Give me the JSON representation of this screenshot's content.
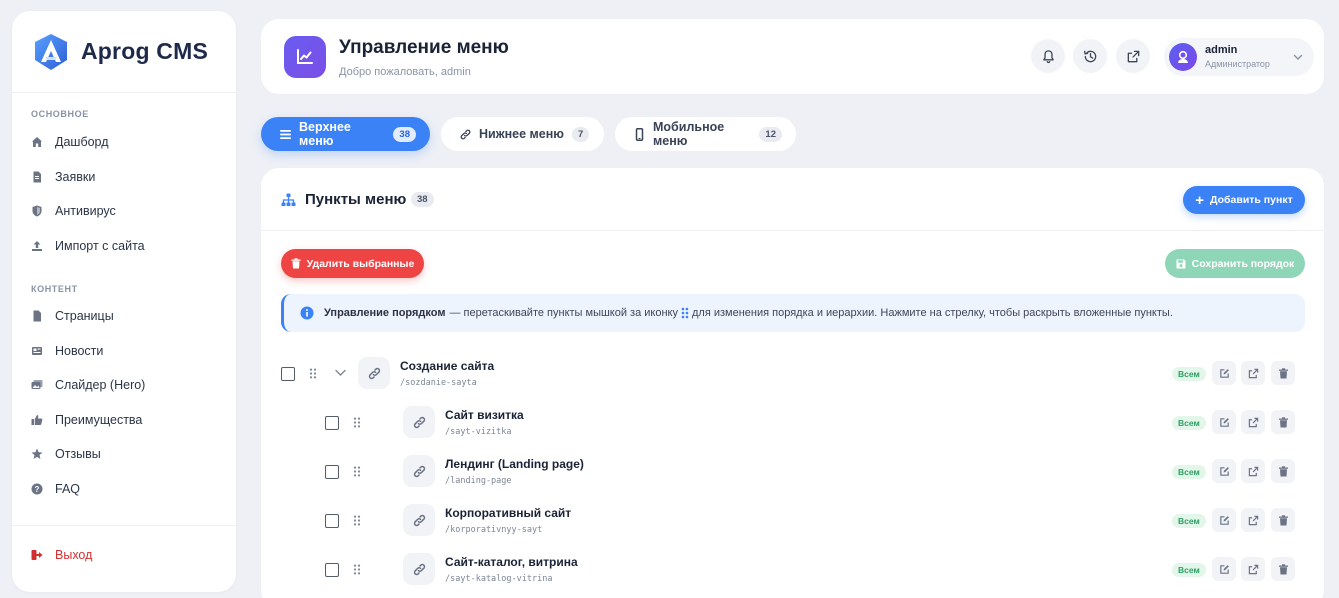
{
  "brand": {
    "name": "Aprog CMS"
  },
  "sidebar": {
    "section_main": "ОСНОВНОЕ",
    "main_items": [
      {
        "label": "Дашборд",
        "icon": "home-icon"
      },
      {
        "label": "Заявки",
        "icon": "file-icon"
      },
      {
        "label": "Антивирус",
        "icon": "shield-icon"
      },
      {
        "label": "Импорт с сайта",
        "icon": "upload-icon"
      }
    ],
    "section_content": "КОНТЕНТ",
    "content_items": [
      {
        "label": "Страницы",
        "icon": "page-icon"
      },
      {
        "label": "Новости",
        "icon": "newspaper-icon"
      },
      {
        "label": "Слайдер (Hero)",
        "icon": "images-icon"
      },
      {
        "label": "Преимущества",
        "icon": "thumbs-up-icon"
      },
      {
        "label": "Отзывы",
        "icon": "star-icon"
      },
      {
        "label": "FAQ",
        "icon": "question-icon"
      }
    ],
    "logout": "Выход"
  },
  "header": {
    "title": "Управление меню",
    "subtitle": "Добро пожаловать, admin",
    "user_name": "admin",
    "user_role": "Администратор"
  },
  "tabs": [
    {
      "label": "Верхнее меню",
      "count": "38",
      "icon": "bars-icon",
      "active": true
    },
    {
      "label": "Нижнее меню",
      "count": "7",
      "icon": "link-icon",
      "active": false
    },
    {
      "label": "Мобильное меню",
      "count": "12",
      "icon": "mobile-icon",
      "active": false
    }
  ],
  "panel": {
    "title": "Пункты меню",
    "count": "38",
    "add_label": "Добавить пункт",
    "delete_label": "Удалить выбранные",
    "save_label": "Сохранить порядок",
    "info_bold": "Управление порядком",
    "info_text_1": "— перетаскивайте пункты мышкой за иконку",
    "info_text_2": "для изменения порядка и иерархии. Нажмите на стрелку, чтобы раскрыть вложенные пункты."
  },
  "items": [
    {
      "title": "Создание сайта",
      "slug": "/sozdanie-sayta",
      "badge": "Всем"
    },
    {
      "title": "Сайт визитка",
      "slug": "/sayt-vizitka",
      "badge": "Всем"
    },
    {
      "title": "Лендинг (Landing page)",
      "slug": "/landing-page",
      "badge": "Всем"
    },
    {
      "title": "Корпоративный сайт",
      "slug": "/korporativnyy-sayt",
      "badge": "Всем"
    },
    {
      "title": "Сайт-каталог, витрина",
      "slug": "/sayt-katalog-vitrina",
      "badge": "Всем"
    }
  ],
  "colors": {
    "primary": "#3b82f6",
    "danger": "#ef4444",
    "success_soft": "#8fd6b8",
    "accent": "#6a5cf0"
  }
}
